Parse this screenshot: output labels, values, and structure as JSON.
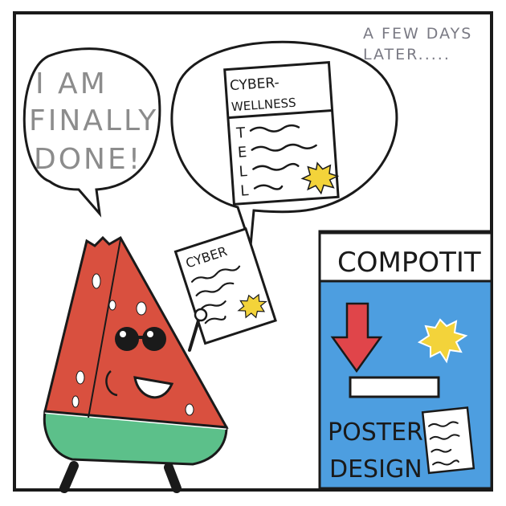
{
  "caption": {
    "line1": "A FEW DAYS",
    "line2": "LATER....."
  },
  "speech": {
    "line1": "I AM",
    "line2": "FINALLY",
    "line3": "DONE!"
  },
  "thought_poster": {
    "title_line1": "CYBER-",
    "title_line2": "WELLNESS",
    "letters": [
      "T",
      "E",
      "L",
      "L"
    ]
  },
  "handheld_paper": {
    "title": "CYBER"
  },
  "competition_poster": {
    "header": "COMPOTIT",
    "footer_line1": "POSTER",
    "footer_line2": "DESIGN"
  },
  "colors": {
    "ink": "#1a1a1a",
    "caption_ink": "#7a7a84",
    "speech_ink": "#8c8c8c",
    "melon_red": "#d9503f",
    "rind_green": "#5cc08a",
    "poster_blue": "#4d9ee0",
    "arrow_red": "#e0454a",
    "sun_yellow": "#f3d33a"
  }
}
